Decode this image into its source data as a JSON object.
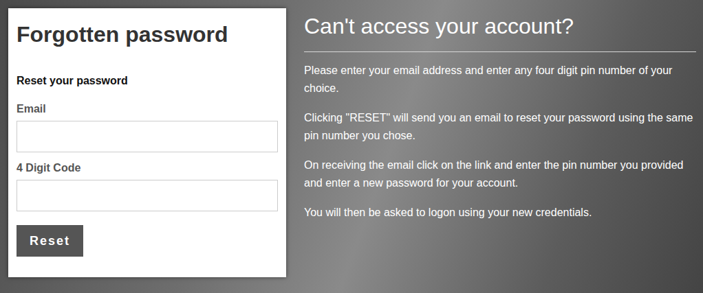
{
  "card": {
    "title": "Forgotten password",
    "subtitle": "Reset your password",
    "fields": [
      {
        "label": "Email",
        "value": ""
      },
      {
        "label": "4 Digit Code",
        "value": ""
      }
    ],
    "button": "Reset"
  },
  "info": {
    "heading": "Can't access your account?",
    "paragraphs": [
      "Please enter your email address and enter any four digit pin number of your choice.",
      "Clicking \"RESET\" will send you an email to reset your password using the same pin number you chose.",
      "On receiving the email click on the link and enter the pin number you provided and enter a new password for your account.",
      "You will then be asked to logon using your new credentials."
    ]
  }
}
